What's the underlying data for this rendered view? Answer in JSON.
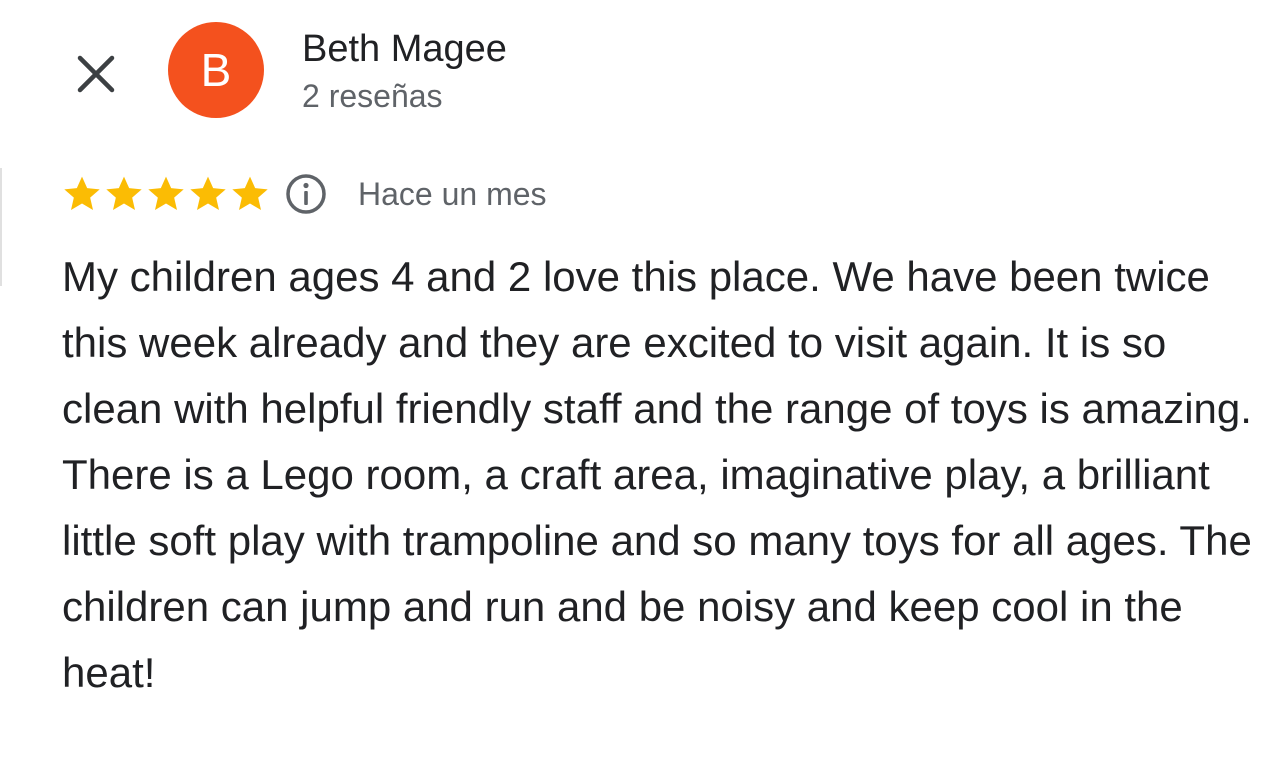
{
  "header": {
    "close_icon": "close-icon",
    "avatar_initial": "B",
    "avatar_color": "#f4511e",
    "author_name": "Beth Magee",
    "review_count": "2 reseñas"
  },
  "review": {
    "rating": 5,
    "max_rating": 5,
    "star_color": "#fbbc04",
    "info_icon": "info-icon",
    "time_ago": "Hace un mes",
    "text": "My children ages 4 and 2 love this place. We have been twice this week already and they are excited to visit again. It is so clean with helpful friendly staff and the range of toys is amazing. There is a Lego room, a craft area, imaginative play, a brilliant little soft play with trampoline and so many toys for all ages. The children can jump and run and be noisy and keep cool in the heat!"
  }
}
